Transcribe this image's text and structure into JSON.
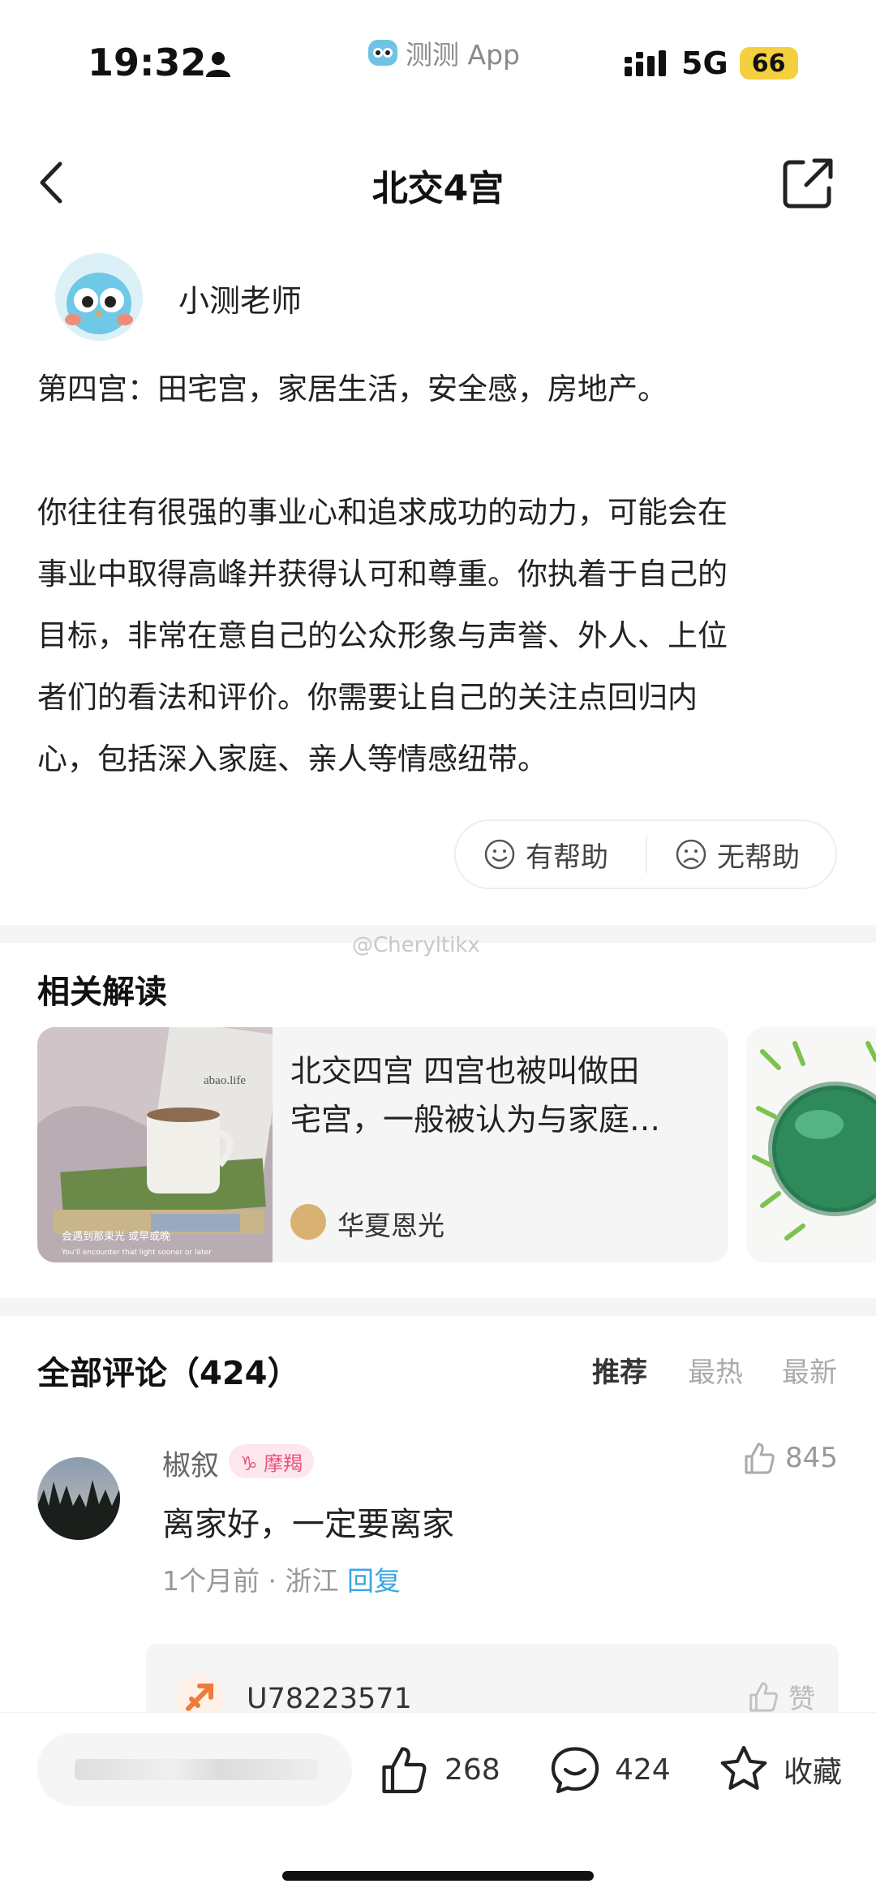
{
  "status_bar": {
    "time": "19:32",
    "app_name": "测测 App",
    "network": "5G",
    "battery": "66"
  },
  "nav": {
    "title": "北交4宫"
  },
  "author": {
    "name": "小测老师"
  },
  "article": {
    "paragraph1": "第四宫：田宅宫，家居生活，安全感，房地产。",
    "paragraph2_lines": [
      "你往往有很强的事业心和追求成功的动力，可能会在",
      "事业中取得高峰并获得认可和尊重。你执着于自己的",
      "目标，非常在意自己的公众形象与声誉、外人、上位",
      "者们的看法和评价。你需要让自己的关注点回归内",
      "心，包括深入家庭、亲人等情感纽带。"
    ]
  },
  "feedback": {
    "helpful": "有帮助",
    "unhelpful": "无帮助"
  },
  "watermark": "@Cheryltikx",
  "related": {
    "title": "相关解读",
    "card": {
      "line1": "北交四宫 四宫也被叫做田",
      "line2": "宅宫，一般被认为与家庭…",
      "author": "华夏恩光",
      "image_brand": "abao.life",
      "image_caption_cn": "会遇到那束光 或早或晚",
      "image_caption_en": "You'll encounter that light sooner or later"
    }
  },
  "comments": {
    "title": "全部评论（424）",
    "sort": [
      "推荐",
      "最热",
      "最新"
    ],
    "items": [
      {
        "user": "椒叙",
        "zodiac": "♑ 摩羯",
        "likes": "845",
        "text": "离家好，一定要离家",
        "meta": "1个月前 · 浙江",
        "reply_label": "回复"
      }
    ],
    "reply": {
      "user": "U78223571",
      "like_label": "赞"
    }
  },
  "bottom_bar": {
    "likes": "268",
    "comments": "424",
    "favorite": "收藏"
  },
  "colors": {
    "accent_blue": "#3ba5e0",
    "zodiac_pink": "#e8547b",
    "battery": "#f4d03f"
  }
}
